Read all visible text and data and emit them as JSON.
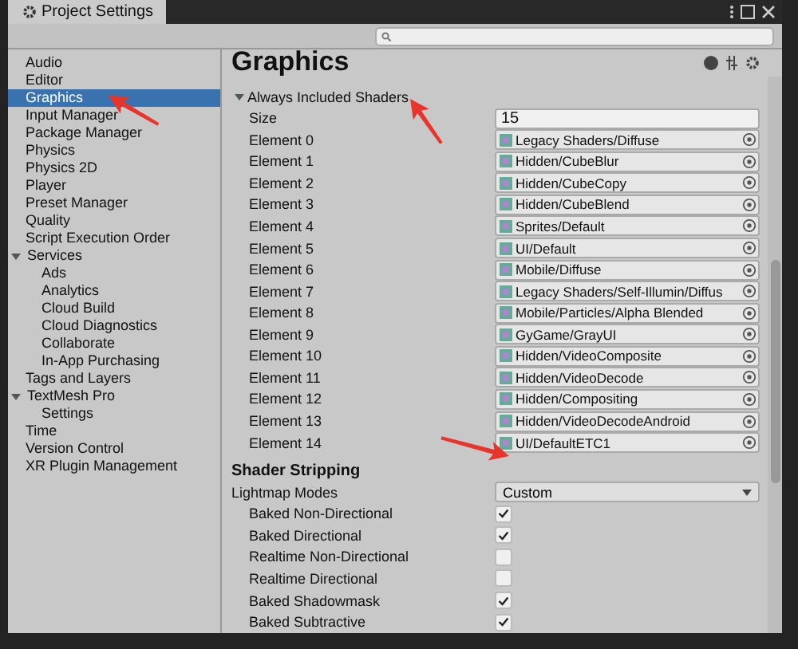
{
  "window": {
    "title": "Project Settings"
  },
  "sidebar": {
    "items": [
      {
        "label": "Audio",
        "selected": false
      },
      {
        "label": "Editor",
        "selected": false
      },
      {
        "label": "Graphics",
        "selected": true
      },
      {
        "label": "Input Manager",
        "selected": false
      },
      {
        "label": "Package Manager",
        "selected": false
      },
      {
        "label": "Physics",
        "selected": false
      },
      {
        "label": "Physics 2D",
        "selected": false
      },
      {
        "label": "Player",
        "selected": false
      },
      {
        "label": "Preset Manager",
        "selected": false
      },
      {
        "label": "Quality",
        "selected": false
      },
      {
        "label": "Script Execution Order",
        "selected": false
      },
      {
        "label": "Services",
        "selected": false,
        "expanded": true,
        "children": [
          {
            "label": "Ads",
            "selected": false
          },
          {
            "label": "Analytics",
            "selected": false
          },
          {
            "label": "Cloud Build",
            "selected": false
          },
          {
            "label": "Cloud Diagnostics",
            "selected": false
          },
          {
            "label": "Collaborate",
            "selected": false
          },
          {
            "label": "In-App Purchasing",
            "selected": false
          }
        ]
      },
      {
        "label": "Tags and Layers",
        "selected": false
      },
      {
        "label": "TextMesh Pro",
        "selected": false,
        "expanded": true,
        "children": [
          {
            "label": "Settings",
            "selected": false
          }
        ]
      },
      {
        "label": "Time",
        "selected": false
      },
      {
        "label": "Version Control",
        "selected": false
      },
      {
        "label": "XR Plugin Management",
        "selected": false
      }
    ]
  },
  "content": {
    "title": "Graphics",
    "shaders": {
      "label": "Always Included Shaders",
      "expanded": true,
      "size_label": "Size",
      "size": "15",
      "elements": [
        {
          "label": "Element 0",
          "value": "Legacy Shaders/Diffuse"
        },
        {
          "label": "Element 1",
          "value": "Hidden/CubeBlur"
        },
        {
          "label": "Element 2",
          "value": "Hidden/CubeCopy"
        },
        {
          "label": "Element 3",
          "value": "Hidden/CubeBlend"
        },
        {
          "label": "Element 4",
          "value": "Sprites/Default"
        },
        {
          "label": "Element 5",
          "value": "UI/Default"
        },
        {
          "label": "Element 6",
          "value": "Mobile/Diffuse"
        },
        {
          "label": "Element 7",
          "value": "Legacy Shaders/Self-Illumin/Diffus"
        },
        {
          "label": "Element 8",
          "value": "Mobile/Particles/Alpha Blended"
        },
        {
          "label": "Element 9",
          "value": "GyGame/GrayUI"
        },
        {
          "label": "Element 10",
          "value": "Hidden/VideoComposite"
        },
        {
          "label": "Element 11",
          "value": "Hidden/VideoDecode"
        },
        {
          "label": "Element 12",
          "value": "Hidden/Compositing"
        },
        {
          "label": "Element 13",
          "value": "Hidden/VideoDecodeAndroid"
        },
        {
          "label": "Element 14",
          "value": "UI/DefaultETC1"
        }
      ]
    },
    "stripping": {
      "title": "Shader Stripping",
      "mode_label": "Lightmap Modes",
      "mode": "Custom",
      "options": [
        {
          "label": "Baked Non-Directional",
          "checked": true
        },
        {
          "label": "Baked Directional",
          "checked": true
        },
        {
          "label": "Realtime Non-Directional",
          "checked": false
        },
        {
          "label": "Realtime Directional",
          "checked": false
        },
        {
          "label": "Baked Shadowmask",
          "checked": true
        },
        {
          "label": "Baked Subtractive",
          "checked": true
        }
      ]
    }
  }
}
